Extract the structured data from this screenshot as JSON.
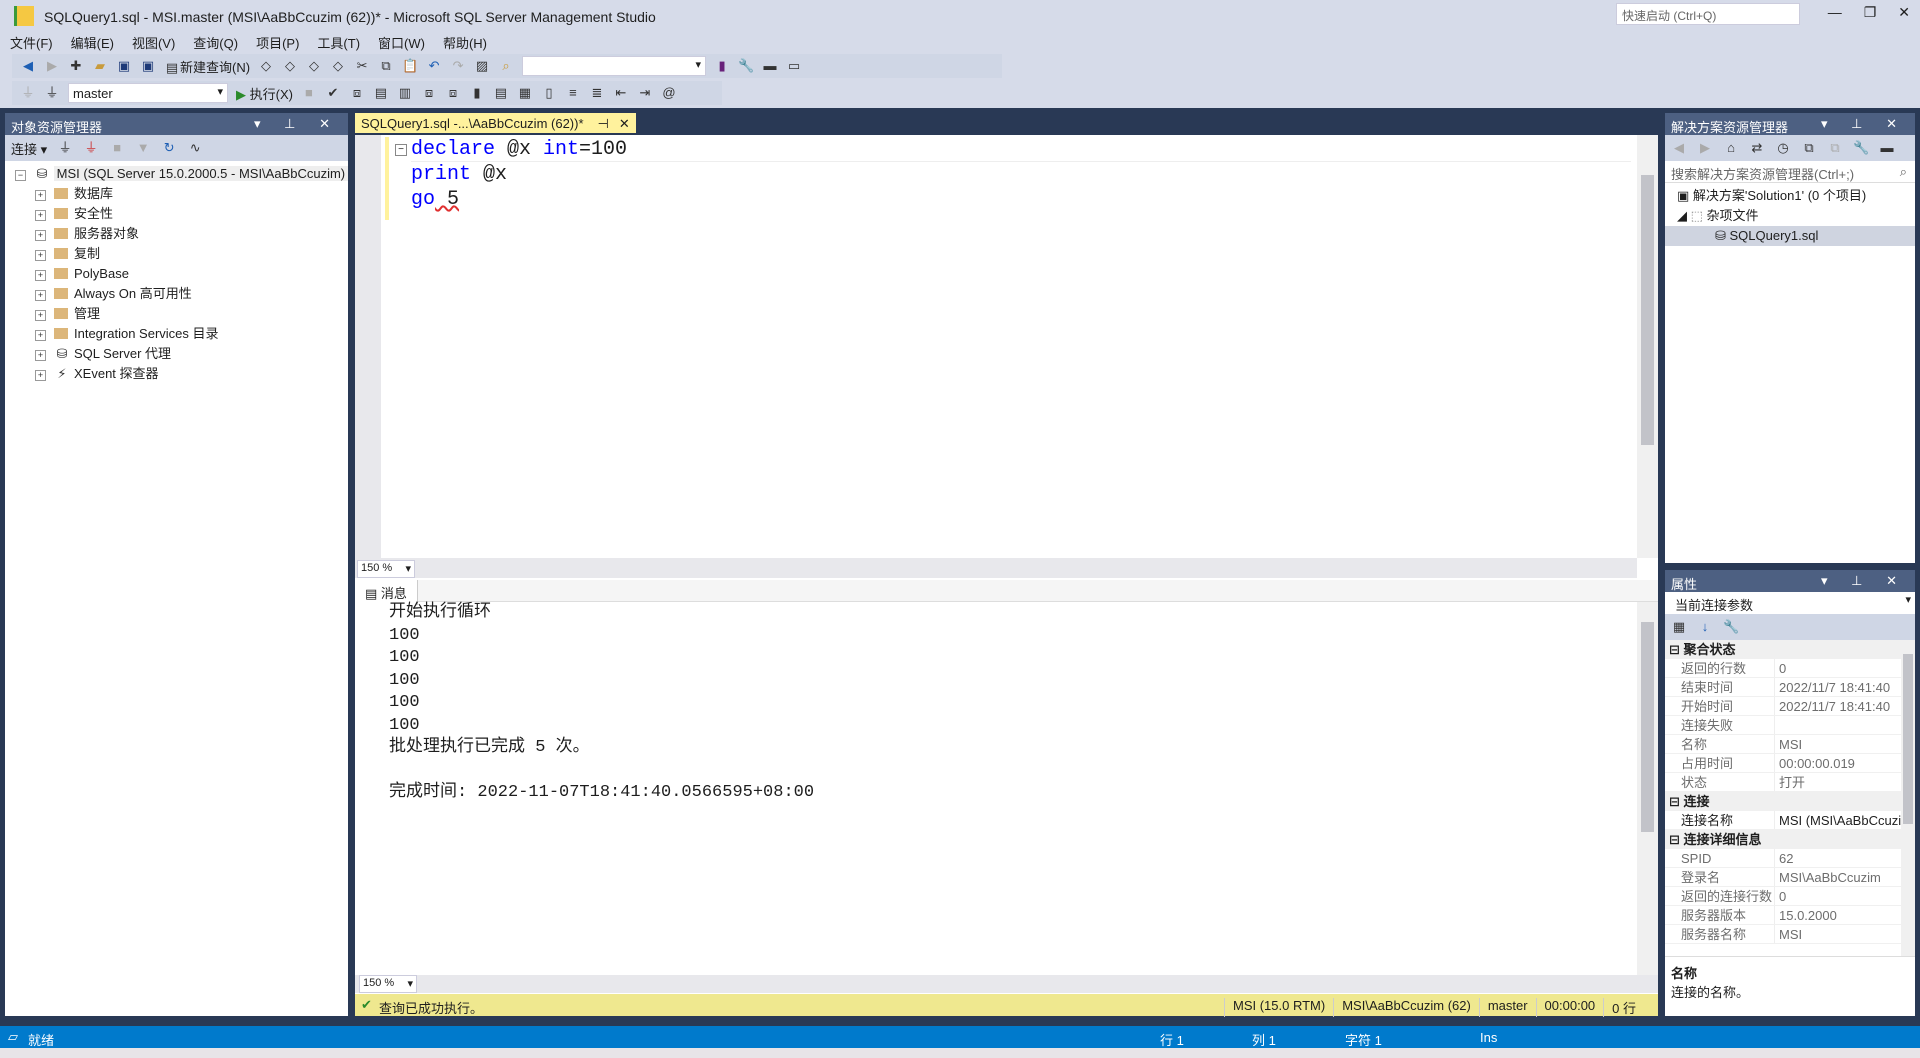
{
  "window": {
    "title": "SQLQuery1.sql - MSI.master (MSI\\AaBbCcuzim (62))* - Microsoft SQL Server Management Studio",
    "quick_launch": "快速启动 (Ctrl+Q)"
  },
  "menu": [
    "文件(F)",
    "编辑(E)",
    "视图(V)",
    "查询(Q)",
    "项目(P)",
    "工具(T)",
    "窗口(W)",
    "帮助(H)"
  ],
  "toolbar": {
    "new_query": "新建查询(N)",
    "database": "master",
    "execute": "执行(X)"
  },
  "object_explorer": {
    "title": "对象资源管理器",
    "connect": "连接",
    "server": "MSI (SQL Server 15.0.2000.5 - MSI\\AaBbCcuzim)",
    "nodes": [
      "数据库",
      "安全性",
      "服务器对象",
      "复制",
      "PolyBase",
      "Always On 高可用性",
      "管理",
      "Integration Services 目录",
      "SQL Server 代理",
      "XEvent 探查器"
    ]
  },
  "editor": {
    "tab": "SQLQuery1.sql -...\\AaBbCcuzim (62))*",
    "lines": [
      [
        "declare",
        " @x ",
        "int",
        "=100"
      ],
      [
        "print",
        " @x"
      ],
      [
        "go",
        " 5"
      ]
    ],
    "zoom": "150 %"
  },
  "results": {
    "tab": "消息",
    "lines": [
      "开始执行循环",
      "100",
      "100",
      "100",
      "100",
      "100",
      "批处理执行已完成 5 次。",
      "",
      "完成时间: 2022-11-07T18:41:40.0566595+08:00"
    ],
    "zoom": "150 %"
  },
  "query_status": {
    "message": "查询已成功执行。",
    "server": "MSI (15.0 RTM)",
    "user": "MSI\\AaBbCcuzim (62)",
    "db": "master",
    "time": "00:00:00",
    "rows": "0 行"
  },
  "solution_explorer": {
    "title": "解决方案资源管理器",
    "search_placeholder": "搜索解决方案资源管理器(Ctrl+;)",
    "solution": "解决方案'Solution1' (0 个项目)",
    "folder": "杂项文件",
    "file": "SQLQuery1.sql"
  },
  "properties": {
    "title": "属性",
    "object": "当前连接参数",
    "groups": [
      {
        "name": "聚合状态",
        "rows": [
          [
            "返回的行数",
            "0"
          ],
          [
            "结束时间",
            "2022/11/7 18:41:40"
          ],
          [
            "开始时间",
            "2022/11/7 18:41:40"
          ],
          [
            "连接失败",
            ""
          ],
          [
            "名称",
            "MSI"
          ],
          [
            "占用时间",
            "00:00:00.019"
          ],
          [
            "状态",
            "打开"
          ]
        ]
      },
      {
        "name": "连接",
        "rows": [
          [
            "连接名称",
            "MSI (MSI\\AaBbCcuzim)"
          ]
        ]
      },
      {
        "name": "连接详细信息",
        "rows": [
          [
            "SPID",
            "62"
          ],
          [
            "登录名",
            "MSI\\AaBbCcuzim"
          ],
          [
            "返回的连接行数",
            "0"
          ],
          [
            "服务器版本",
            "15.0.2000"
          ],
          [
            "服务器名称",
            "MSI"
          ]
        ]
      }
    ],
    "desc_title": "名称",
    "desc_text": "连接的名称。"
  },
  "statusbar": {
    "ready": "就绪",
    "line": "行 1",
    "col": "列 1",
    "char": "字符 1",
    "mode": "Ins"
  }
}
